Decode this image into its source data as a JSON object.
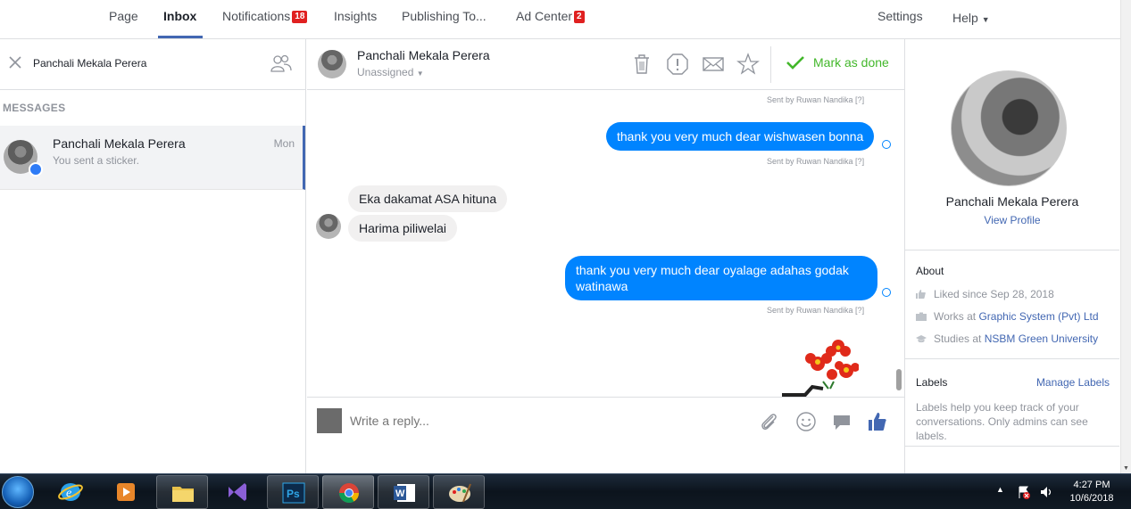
{
  "nav": {
    "items": [
      {
        "label": "Page"
      },
      {
        "label": "Inbox"
      },
      {
        "label": "Notifications",
        "badge": "18"
      },
      {
        "label": "Insights"
      },
      {
        "label": "Publishing To..."
      },
      {
        "label": "Ad Center",
        "badge": "2"
      }
    ],
    "settings": "Settings",
    "help": "Help"
  },
  "left": {
    "search_value": "Panchali Mekala Perera",
    "section": "MESSAGES",
    "thread": {
      "name": "Panchali Mekala Perera",
      "snippet": "You sent a sticker.",
      "time": "Mon"
    }
  },
  "conversation": {
    "header": {
      "name": "Panchali Mekala Perera",
      "assignee": "Unassigned",
      "mark_done": "Mark as done"
    },
    "sent_by_1": "Sent by Ruwan Nandika  [?]",
    "msg_out_1": "thank you very much dear  wishwasen bonna",
    "sent_by_2": "Sent by Ruwan Nandika  [?]",
    "msg_in_1": "Eka dakamat ASA hituna",
    "msg_in_2": "Harima piliwelai",
    "msg_out_2": "thank you very much dear oyalage adahas godak watinawa",
    "sent_by_3": "Sent by Ruwan Nandika  [?]",
    "composer_placeholder": "Write a reply..."
  },
  "right": {
    "name": "Panchali Mekala Perera",
    "view_profile": "View Profile",
    "about_title": "About",
    "liked_since": "Liked since Sep 28, 2018",
    "works_prefix": "Works at ",
    "works_link": "Graphic System (Pvt) Ltd",
    "studies_prefix": "Studies at ",
    "studies_link": "NSBM Green University",
    "labels_title": "Labels",
    "manage_labels": "Manage Labels",
    "labels_help": "Labels help you keep track of your conversations. Only admins can see labels."
  },
  "taskbar": {
    "time": "4:27 PM",
    "date": "10/6/2018"
  },
  "colors": {
    "brand": "#4267b2",
    "bubble_out": "#0084ff",
    "done_green": "#42b72a",
    "badge_red": "#e02020"
  }
}
